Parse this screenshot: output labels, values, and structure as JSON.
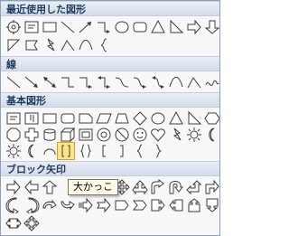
{
  "sections": {
    "recent": "最近使用した図形",
    "lines": "線",
    "basic": "基本図形",
    "block_arrows": "ブロック矢印"
  },
  "tooltip": "大かっこ"
}
